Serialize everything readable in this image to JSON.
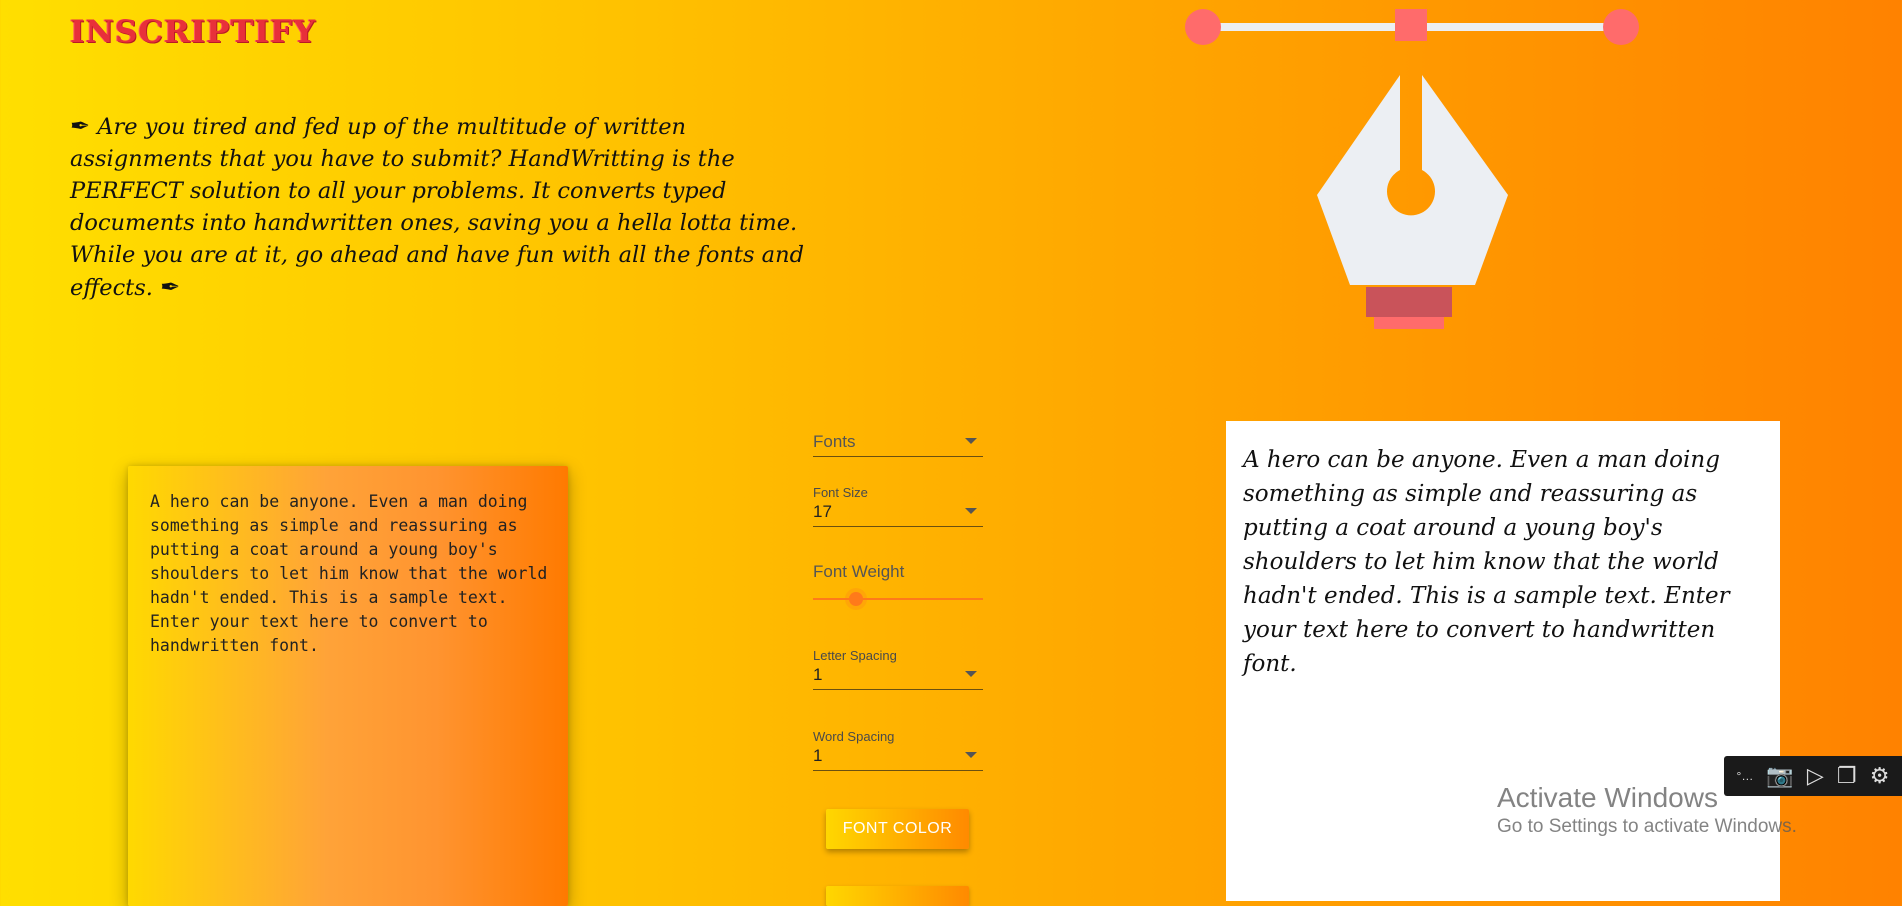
{
  "app": {
    "logo": "INSCRIPTIFY"
  },
  "intro": {
    "pen_glyph": "✒",
    "text": "Are you tired and fed up of the multitude of written assignments that you have to submit? HandWritting is the PERFECT solution to all your problems. It converts typed documents into handwritten ones, saving you a hella lotta time. While you are at it, go ahead and have fun with all the fonts and effects."
  },
  "input": {
    "value": "A hero can be anyone. Even a man doing something as simple and reassuring as putting a coat around a young boy's shoulders to let him know that the world hadn't ended. This is a sample text. Enter your text here to convert to handwritten font."
  },
  "controls": {
    "fonts": {
      "placeholder": "Fonts"
    },
    "font_size": {
      "label": "Font Size",
      "value": "17"
    },
    "font_weight": {
      "label": "Font Weight",
      "level": 0.25
    },
    "letter_spacing": {
      "label": "Letter Spacing",
      "value": "1"
    },
    "word_spacing": {
      "label": "Word Spacing",
      "value": "1"
    },
    "font_color_button": "FONT COLOR"
  },
  "output": {
    "text": "A hero can be anyone. Even a man doing something as simple and reassuring as putting a coat around a young boy's shoulders to let him know that the world hadn't ended. This is a sample text. Enter your text here to convert to handwritten font."
  },
  "watermark": {
    "line1": "Activate Windows",
    "line2": "Go to Settings to activate Windows."
  },
  "capture_toolbar": {
    "icons": [
      "more-icon",
      "camera-icon",
      "video-icon",
      "window-icon",
      "gear-icon"
    ]
  },
  "colors": {
    "accent_red": "#ff6b6b",
    "pen_body": "#eceff3",
    "pen_band": "#c9535a",
    "slider": "#ff7a1a"
  }
}
